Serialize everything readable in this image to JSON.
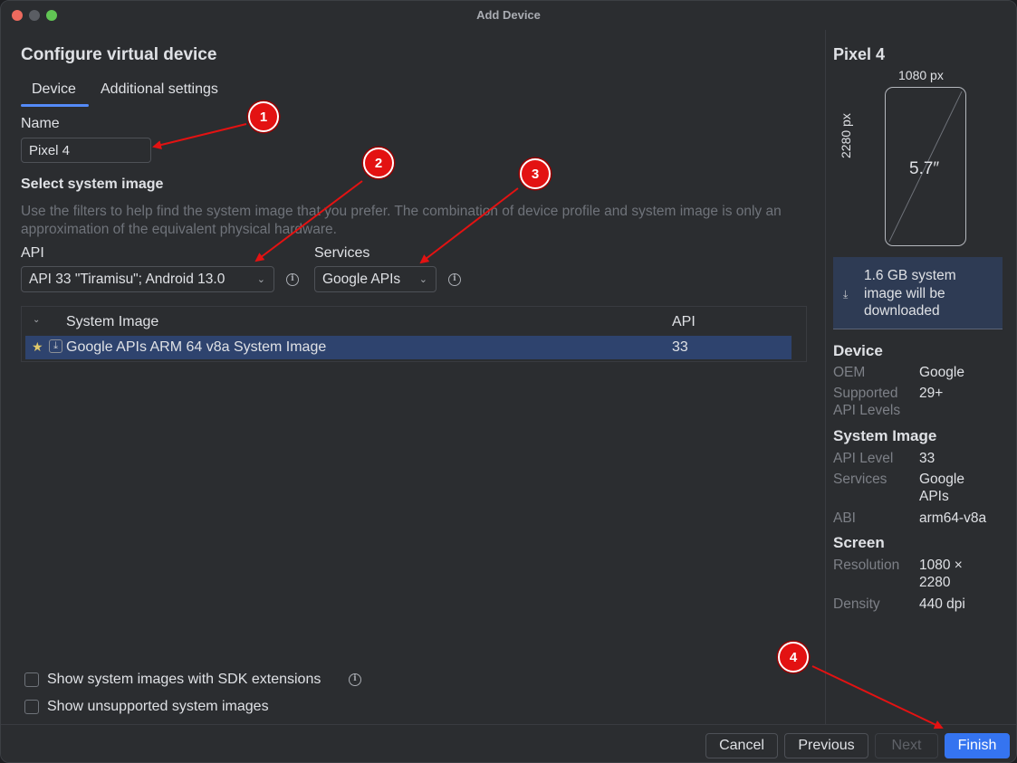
{
  "window": {
    "title": "Add Device"
  },
  "left": {
    "heading": "Configure virtual device",
    "tabs": [
      {
        "label": "Device"
      },
      {
        "label": "Additional settings"
      }
    ],
    "name_label": "Name",
    "name_value": "Pixel 4",
    "system_image_title": "Select system image",
    "hint": "Use the filters to help find the system image that you prefer. The combination of device profile and system image is only an approximation of the equivalent physical hardware.",
    "api_label": "API",
    "api_value": "API 33 \"Tiramisu\"; Android 13.0",
    "services_label": "Services",
    "services_value": "Google APIs",
    "table": {
      "headers": [
        "System Image",
        "API"
      ],
      "rows": [
        {
          "name": "Google APIs ARM 64 v8a System Image",
          "api": "33"
        }
      ]
    },
    "checkboxes": [
      {
        "label": "Show system images with SDK extensions",
        "checked": false
      },
      {
        "label": "Show unsupported system images",
        "checked": false
      }
    ]
  },
  "right": {
    "title": "Pixel 4",
    "width_px": "1080 px",
    "height_px": "2280 px",
    "diagonal": "5.7″",
    "download_note": "1.6 GB system image will be downloaded",
    "device": {
      "heading": "Device",
      "oem_key": "OEM",
      "oem_val": "Google",
      "api_key": "Supported API Levels",
      "api_val": "29+"
    },
    "system_image": {
      "heading": "System Image",
      "level_key": "API Level",
      "level_val": "33",
      "services_key": "Services",
      "services_val": "Google APIs",
      "abi_key": "ABI",
      "abi_val": "arm64-v8a"
    },
    "screen": {
      "heading": "Screen",
      "res_key": "Resolution",
      "res_val": "1080 × 2280",
      "density_key": "Density",
      "density_val": "440 dpi"
    }
  },
  "footer": {
    "cancel": "Cancel",
    "previous": "Previous",
    "next": "Next",
    "finish": "Finish"
  },
  "annotations": [
    "1",
    "2",
    "3",
    "4"
  ],
  "colors": {
    "accent": "#3574f0",
    "selection": "#2e436e",
    "annotation_red": "#e31212"
  }
}
